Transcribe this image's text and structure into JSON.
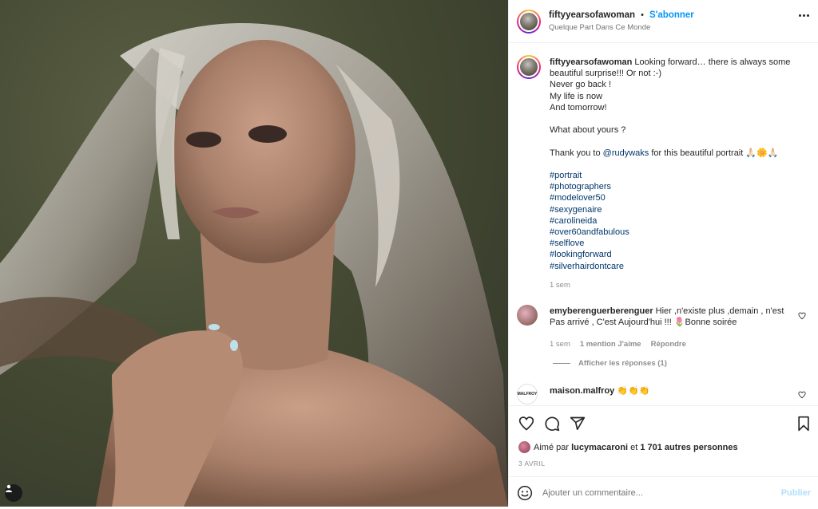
{
  "header": {
    "username": "fiftyyearsofawoman",
    "separator": "•",
    "follow_label": "S'abonner",
    "location": "Quelque Part Dans Ce Monde"
  },
  "caption": {
    "username": "fiftyyearsofawoman",
    "line1": "Looking forward… there is always some beautiful surprise!!! Or not :-)",
    "line2": "Never go back !",
    "line3": "My life is now",
    "line4": "And tomorrow!",
    "line5": "What about yours ?",
    "thanks_prefix": "Thank you to",
    "thanks_mention": "@rudywaks",
    "thanks_suffix": "for this beautiful portrait 🙏🏻🌼🙏🏻",
    "hashtags": [
      "#portrait",
      "#photographers",
      "#modelover50",
      "#sexygenaire",
      "#carolineida",
      "#over60andfabulous",
      "#selflove",
      "#lookingforward",
      "#silverhairdontcare"
    ],
    "time": "1 sem"
  },
  "comments": [
    {
      "username": "emyberenguerberenguer",
      "text": "Hier ,n'existe plus ,demain , n'est Pas arrivé , C'est Aujourd'hui !!! 🌷Bonne soirée",
      "time": "1 sem",
      "likes": "1 mention J'aime",
      "reply": "Répondre",
      "view_replies": "Afficher les réponses (1)"
    },
    {
      "username": "maison.malfroy",
      "text": "👏👏👏",
      "avatar_text": "MALFROY"
    }
  ],
  "actions": {
    "liked_prefix": "Aimé par",
    "liked_user": "lucymacaroni",
    "liked_and": "et",
    "liked_others": "1 701 autres personnes",
    "date": "3 AVRIL"
  },
  "comment_box": {
    "placeholder": "Ajouter un commentaire...",
    "publish": "Publier"
  },
  "colors": {
    "accent": "#0095f6",
    "link": "#00376b",
    "muted": "#8e8e8e",
    "publish_disabled": "#b2dffc",
    "photo_background": "#454a33"
  },
  "icons": [
    "heart-icon",
    "comment-icon",
    "share-icon",
    "bookmark-icon",
    "emoji-icon",
    "more-options-icon",
    "user-tag-icon"
  ]
}
